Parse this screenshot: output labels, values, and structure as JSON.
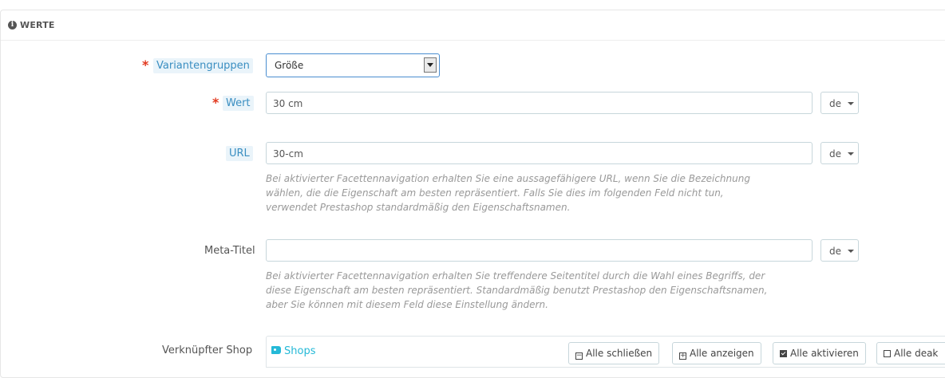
{
  "panel": {
    "title": "WERTE",
    "title_icon": "info-circle-icon"
  },
  "fields": {
    "variantengruppen": {
      "required_mark": "*",
      "label": "Variantengruppen",
      "selected": "Größe"
    },
    "wert": {
      "required_mark": "*",
      "label": "Wert",
      "value": "30 cm",
      "lang": "de"
    },
    "url": {
      "label": "URL",
      "value": "30-cm",
      "lang": "de",
      "help": [
        "Bei aktivierter Facettennavigation erhalten Sie eine aussagefähigere URL, wenn Sie die Bezeichnung",
        "wählen, die die Eigenschaft am besten repräsentiert. Falls Sie dies im folgenden Feld nicht tun,",
        "verwendet Prestashop standardmäßig den Eigenschaftsnamen."
      ]
    },
    "meta_titel": {
      "label": "Meta-Titel",
      "value": "",
      "lang": "de",
      "help": [
        "Bei aktivierter Facettennavigation erhalten Sie treffendere Seitentitel durch die Wahl eines Begriffs, der",
        "diese Eigenschaft am besten repräsentiert. Standardmäßig benutzt Prestashop den Eigenschaftsnamen,",
        "aber Sie können mit diesem Feld diese Einstellung ändern."
      ]
    },
    "shop": {
      "label": "Verknüpfter Shop",
      "tree_label": "Shops",
      "buttons": {
        "collapse": "Alle schließen",
        "expand": "Alle anzeigen",
        "check": "Alle aktivieren",
        "uncheck": "Alle deak"
      }
    }
  },
  "colors": {
    "required": "#e2381e",
    "label_highlight_bg": "#eaf4fa",
    "label_highlight_text": "#3a8ec1",
    "accent": "#25b9d7"
  }
}
